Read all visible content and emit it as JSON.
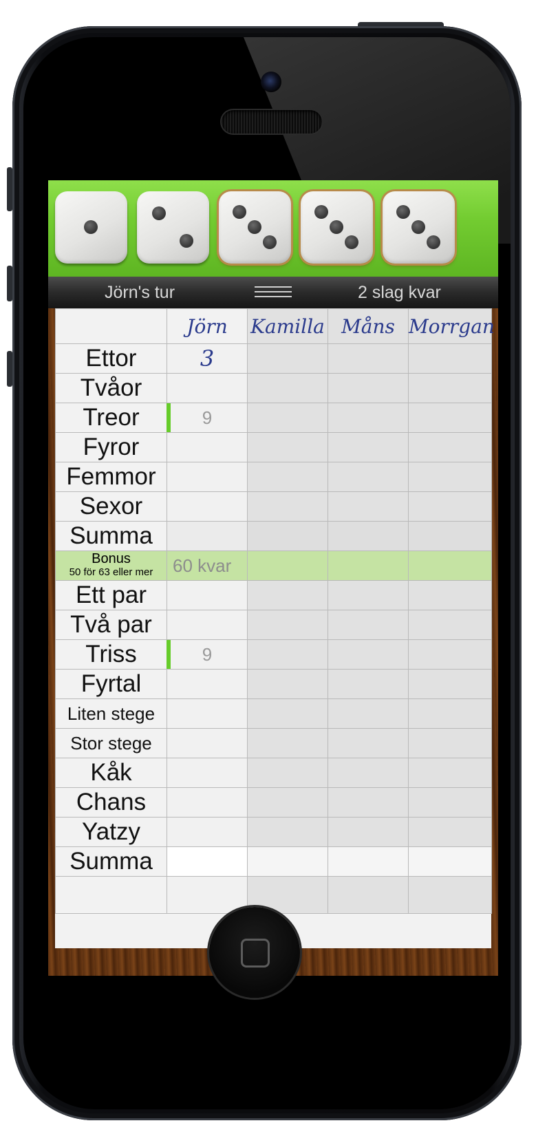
{
  "dice": [
    {
      "value": 1,
      "held": false
    },
    {
      "value": 2,
      "held": false
    },
    {
      "value": 3,
      "held": true
    },
    {
      "value": 3,
      "held": true
    },
    {
      "value": 3,
      "held": true
    }
  ],
  "status": {
    "turn_label": "Jörn's tur",
    "rolls_left_label": "2 slag kvar"
  },
  "players": [
    "Jörn",
    "Kamilla",
    "Måns",
    "Morrgan"
  ],
  "rows": [
    {
      "label": "Ettor",
      "p1": "3",
      "p1_style": "written",
      "size": "big"
    },
    {
      "label": "Tvåor",
      "p1": "",
      "size": "big"
    },
    {
      "label": "Treor",
      "p1": "9",
      "p1_style": "suggestion",
      "size": "big"
    },
    {
      "label": "Fyror",
      "p1": "",
      "size": "big"
    },
    {
      "label": "Femmor",
      "p1": "",
      "size": "big"
    },
    {
      "label": "Sexor",
      "p1": "",
      "size": "big"
    },
    {
      "label": "Summa",
      "p1": "",
      "size": "big",
      "kind": "summa"
    },
    {
      "label": "Bonus",
      "sub": "50 för 63 eller mer",
      "p1": "60 kvar",
      "kind": "bonus"
    },
    {
      "label": "Ett par",
      "p1": "",
      "size": "big"
    },
    {
      "label": "Två par",
      "p1": "",
      "size": "big"
    },
    {
      "label": "Triss",
      "p1": "9",
      "p1_style": "suggestion",
      "size": "big"
    },
    {
      "label": "Fyrtal",
      "p1": "",
      "size": "big"
    },
    {
      "label": "Liten stege",
      "p1": "",
      "size": "small"
    },
    {
      "label": "Stor stege",
      "p1": "",
      "size": "small"
    },
    {
      "label": "Kåk",
      "p1": "",
      "size": "big"
    },
    {
      "label": "Chans",
      "p1": "",
      "size": "big"
    },
    {
      "label": "Yatzy",
      "p1": "",
      "size": "big"
    },
    {
      "label": "Summa",
      "p1": "",
      "size": "big",
      "kind": "total"
    },
    {
      "label": "",
      "p1": "",
      "kind": "empty"
    }
  ],
  "colors": {
    "tray_green": "#73cc31",
    "suggestion_green": "#66cc2a",
    "handwriting_blue": "#2a3a8c",
    "bonus_row": "#c5e3a3"
  }
}
